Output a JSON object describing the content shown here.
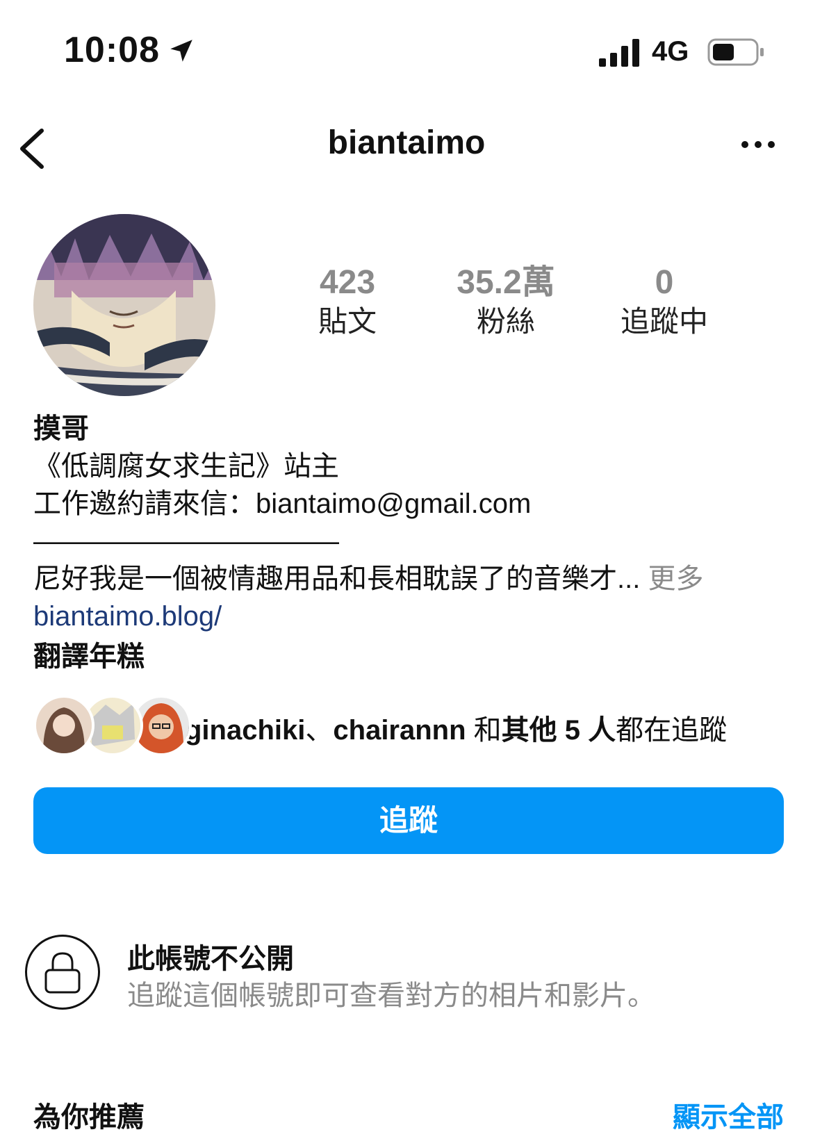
{
  "status_bar": {
    "time": "10:08",
    "network": "4G"
  },
  "nav": {
    "title": "biantaimo"
  },
  "stats": [
    {
      "value": "423",
      "label": "貼文"
    },
    {
      "value": "35.2萬",
      "label": "粉絲"
    },
    {
      "value": "0",
      "label": "追蹤中"
    }
  ],
  "bio": {
    "name": "摸哥",
    "line1": "《低調腐女求生記》站主",
    "line2": "工作邀約請來信：biantaimo@gmail.com",
    "line3": "———————————",
    "line4": "尼好我是一個被情趣用品和長相耽誤了的音樂才...",
    "more": " 更多",
    "website": "biantaimo.blog/",
    "translate": "翻譯年糕"
  },
  "mutuals": {
    "user1": "ginachiki",
    "sep": "、",
    "user2": "chairannn",
    "and": " 和",
    "others": "其他 5 人",
    "suffix": "都在追蹤"
  },
  "follow_button": "追蹤",
  "private": {
    "title": "此帳號不公開",
    "subtitle": "追蹤這個帳號即可查看對方的相片和影片。"
  },
  "suggested": {
    "title": "為你推薦",
    "show_all": "顯示全部"
  },
  "colors": {
    "accent": "#0495f6",
    "link": "#1d3a78",
    "muted": "#8a8a8a"
  }
}
